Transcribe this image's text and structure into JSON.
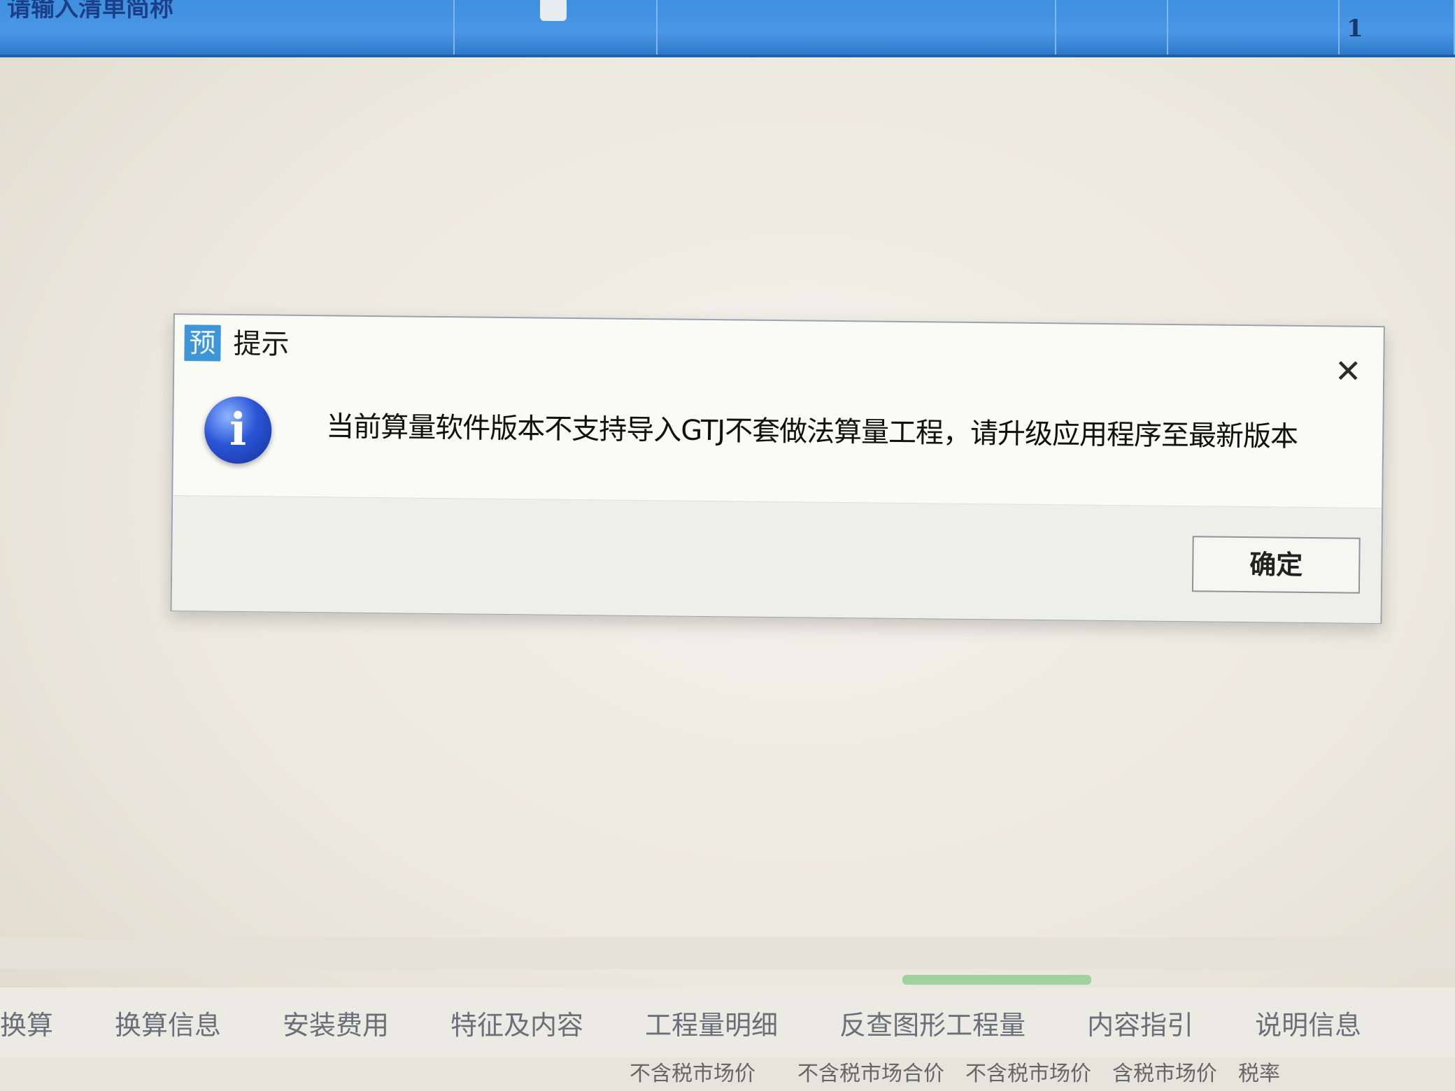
{
  "top_grid": {
    "first_cell_text": "请输入清单简称",
    "last_cell_value": "1"
  },
  "dialog": {
    "title": "提示",
    "app_icon_glyph": "预",
    "close_glyph": "✕",
    "info_icon_glyph": "i",
    "message": "当前算量软件版本不支持导入GTJ不套做法算量工程，请升级应用程序至最新版本",
    "ok_label": "确定"
  },
  "bottom_tabs": [
    "换算",
    "换算信息",
    "安装费用",
    "特征及内容",
    "工程量明细",
    "反查图形工程量",
    "内容指引",
    "说明信息"
  ],
  "bottom_partial_text": "不含税市场价　　不含税市场合价　不含税市场价　含税市场价　税率",
  "colors": {
    "grid_blue": "#3f8fe0",
    "info_blue": "#2a55d6",
    "app_icon_blue": "#3f96d6"
  }
}
